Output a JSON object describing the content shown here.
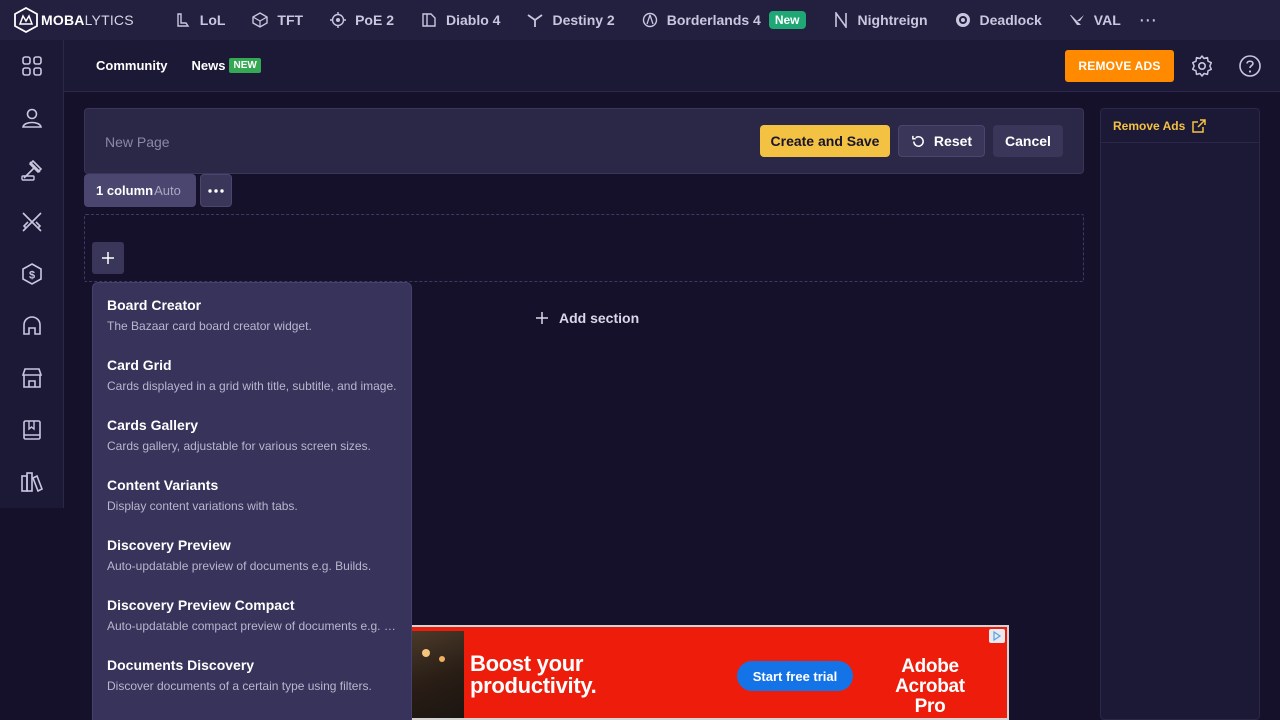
{
  "brand": {
    "name_bold": "MOBA",
    "name_light": "LYTICS"
  },
  "games": [
    {
      "label": "LoL",
      "icon": "lol-icon"
    },
    {
      "label": "TFT",
      "icon": "tft-icon"
    },
    {
      "label": "PoE 2",
      "icon": "poe2-icon"
    },
    {
      "label": "Diablo 4",
      "icon": "diablo4-icon"
    },
    {
      "label": "Destiny 2",
      "icon": "destiny2-icon"
    },
    {
      "label": "Borderlands 4",
      "icon": "borderlands4-icon",
      "badge": "New"
    },
    {
      "label": "Nightreign",
      "icon": "nightreign-icon"
    },
    {
      "label": "Deadlock",
      "icon": "deadlock-icon"
    },
    {
      "label": "VAL",
      "icon": "valorant-icon"
    }
  ],
  "subheader": {
    "community": "Community",
    "news": "News",
    "news_badge": "NEW",
    "remove_ads": "REMOVE ADS"
  },
  "editor": {
    "page_name_placeholder": "New Page",
    "page_name_value": "",
    "create_save": "Create and Save",
    "reset": "Reset",
    "cancel": "Cancel",
    "columns_label": "1 column",
    "columns_mode": "Auto",
    "add_section": "Add section"
  },
  "widgets": [
    {
      "title": "Board Creator",
      "desc": "The Bazaar card board creator widget."
    },
    {
      "title": "Card Grid",
      "desc": "Cards displayed in a grid with title, subtitle, and image."
    },
    {
      "title": "Cards Gallery",
      "desc": "Cards gallery, adjustable for various screen sizes."
    },
    {
      "title": "Content Variants",
      "desc": "Display content variations with tabs."
    },
    {
      "title": "Discovery Preview",
      "desc": "Auto-updatable preview of documents e.g. Builds."
    },
    {
      "title": "Discovery Preview Compact",
      "desc": "Auto-updatable compact preview of documents e.g. Builds."
    },
    {
      "title": "Documents Discovery",
      "desc": "Discover documents of a certain type using filters."
    }
  ],
  "ad": {
    "headline_line1": "Boost your",
    "headline_line2": "productivity.",
    "cta": "Start free trial",
    "brand_line1": "Adobe",
    "brand_line2": "Acrobat Pro"
  },
  "right_panel": {
    "remove_ads_link": "Remove Ads"
  },
  "colors": {
    "accent_yellow": "#f3c243",
    "orange": "#ff8a00",
    "new_green": "#1fa775",
    "background": "#15112b",
    "ad_red": "#ed1c0b"
  }
}
